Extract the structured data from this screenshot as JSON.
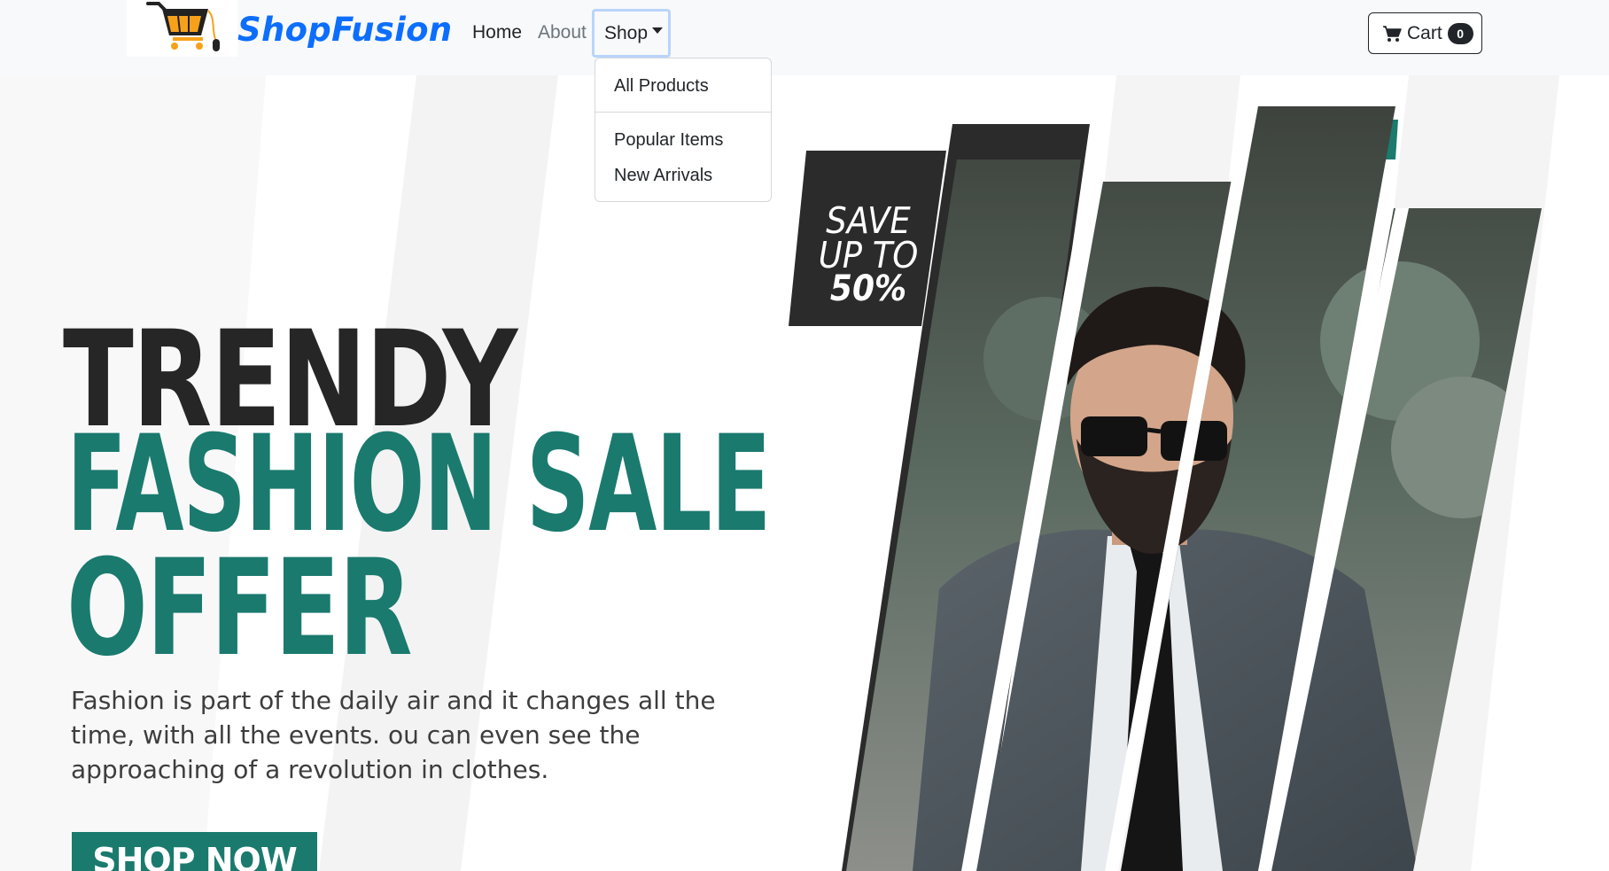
{
  "navbar": {
    "brand": "ShopFusion",
    "links": {
      "home": "Home",
      "about": "About",
      "shop": "Shop"
    },
    "cart": {
      "label": "Cart",
      "count": "0"
    }
  },
  "dropdown": {
    "items": [
      {
        "label": "All Products"
      },
      {
        "label": "Popular Items"
      },
      {
        "label": "New Arrivals"
      }
    ]
  },
  "hero": {
    "headline_1": "TRENDY",
    "headline_2": "FASHION SALE",
    "headline_3": "OFFER",
    "tagline": "Fashion is part of the daily air and it changes all the time, with all the events. ou can even see the approaching of a revolution in clothes.",
    "cta": "SHOP NOW",
    "save_line_1": "SAVE",
    "save_line_2": "UP TO",
    "save_line_3": "50%"
  },
  "colors": {
    "brand_blue": "#0d6efd",
    "teal": "#1a7a6e",
    "dark": "#262626",
    "navbar_bg": "#f8f9fa"
  }
}
